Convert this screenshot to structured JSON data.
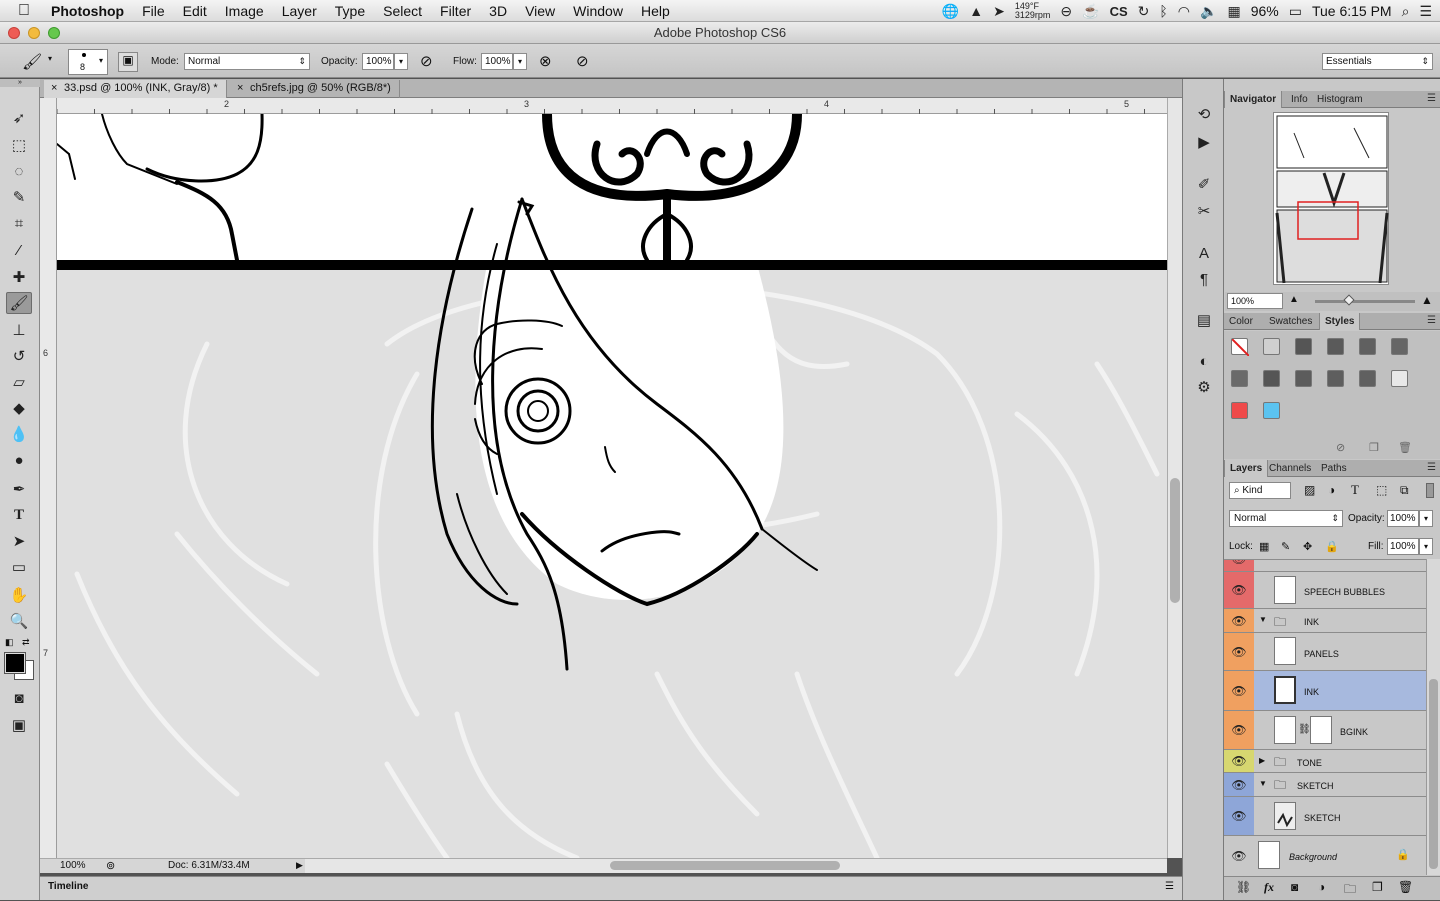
{
  "menubar": {
    "app": "Photoshop",
    "items": [
      "File",
      "Edit",
      "Image",
      "Layer",
      "Type",
      "Select",
      "Filter",
      "3D",
      "View",
      "Window",
      "Help"
    ],
    "temp": "149°F",
    "rpm": "3129rpm",
    "battery": "96%",
    "clock": "Tue 6:15 PM"
  },
  "window": {
    "title": "Adobe Photoshop CS6"
  },
  "options": {
    "brush_size": "8",
    "mode_label": "Mode:",
    "mode_value": "Normal",
    "opacity_label": "Opacity:",
    "opacity_value": "100%",
    "flow_label": "Flow:",
    "flow_value": "100%",
    "workspace": "Essentials"
  },
  "tabs": [
    {
      "label": "33.psd @ 100% (INK, Gray/8) *",
      "active": true
    },
    {
      "label": "ch5refs.jpg @ 50% (RGB/8*)",
      "active": false
    }
  ],
  "rulers": {
    "top": [
      "2",
      "3",
      "4",
      "5"
    ],
    "left": [
      "6",
      "7"
    ]
  },
  "status": {
    "zoom": "100%",
    "doc": "Doc: 6.31M/33.4M"
  },
  "timeline": {
    "label": "Timeline"
  },
  "navigator": {
    "tabs": [
      "Navigator",
      "Info",
      "Histogram"
    ],
    "zoom": "100%"
  },
  "color_panel": {
    "tabs": [
      "Color",
      "Swatches",
      "Styles"
    ],
    "styles": [
      "#d0d0d0",
      "#555555",
      "#5a5a5a",
      "#606060",
      "#666666",
      "#6a6a6a",
      "#555555",
      "#5c5c5c",
      "#5e5e5e",
      "#606060",
      "#e8e8e8",
      "#ef4a4a",
      "#5bc3f0"
    ]
  },
  "layers": {
    "tabs": [
      "Layers",
      "Channels",
      "Paths"
    ],
    "kind": "Kind",
    "blend": "Normal",
    "opacity_label": "Opacity:",
    "opacity": "100%",
    "lock_label": "Lock:",
    "fill_label": "Fill:",
    "fill": "100%",
    "items": [
      {
        "name": "SPEECH BUBBLES",
        "color": "#e46a6a",
        "type": "layer"
      },
      {
        "name": "INK",
        "color": "#f0a060",
        "type": "group"
      },
      {
        "name": "PANELS",
        "color": "#f0a060",
        "type": "layer"
      },
      {
        "name": "INK",
        "color": "#f0a060",
        "type": "layer",
        "selected": true
      },
      {
        "name": "BGINK",
        "color": "#f0a060",
        "type": "masked"
      },
      {
        "name": "TONE",
        "color": "#d7d770",
        "type": "group"
      },
      {
        "name": "SKETCH",
        "color": "#8ea6d8",
        "type": "group"
      },
      {
        "name": "SKETCH",
        "color": "#8ea6d8",
        "type": "layer"
      },
      {
        "name": "Background",
        "color": "#c8c8c8",
        "type": "background"
      }
    ]
  }
}
